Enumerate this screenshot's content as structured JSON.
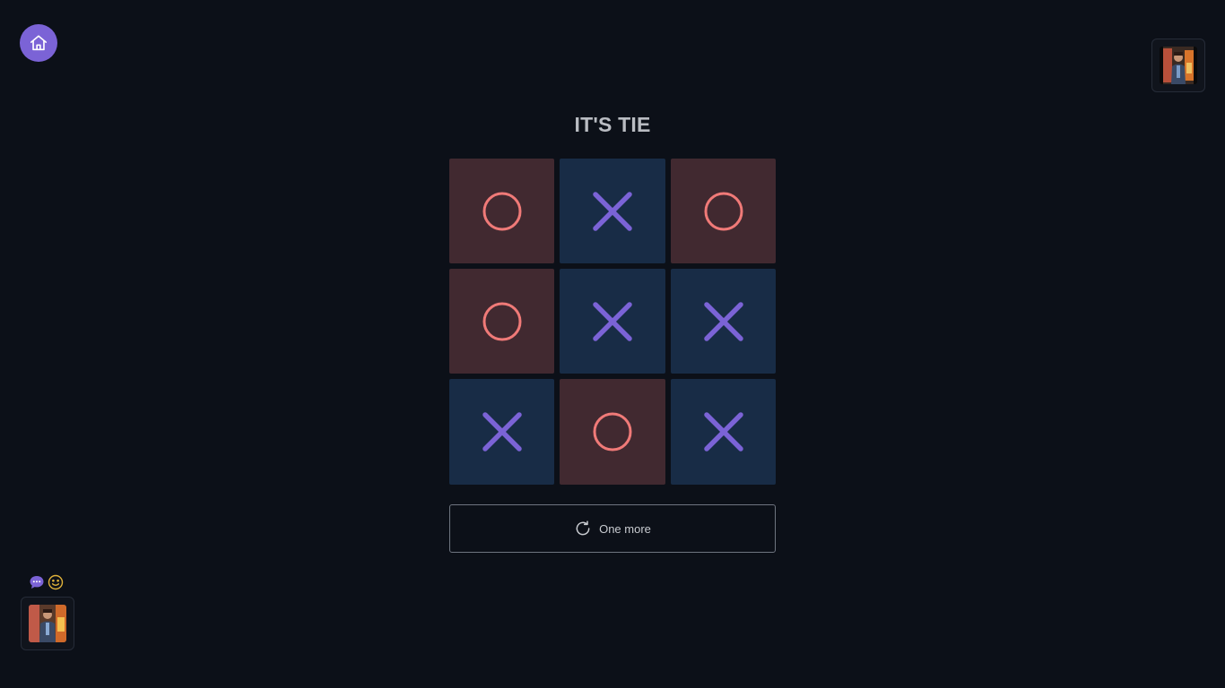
{
  "status": {
    "title": "IT'S TIE"
  },
  "board": {
    "cells": [
      "O",
      "X",
      "O",
      "O",
      "X",
      "X",
      "X",
      "O",
      "X"
    ]
  },
  "actions": {
    "one_more_label": "One more"
  },
  "icons": {
    "home": "home-icon",
    "restart": "refresh-icon",
    "chat": "chat-bubble-icon",
    "emoji": "smiley-icon"
  },
  "colors": {
    "background": "#0c1018",
    "accent": "#7b63d6",
    "o_mark": "#f07a78",
    "x_mark": "#7b63d6",
    "o_cell": "#412930",
    "x_cell": "#182c46",
    "emoji": "#e0b23a"
  }
}
